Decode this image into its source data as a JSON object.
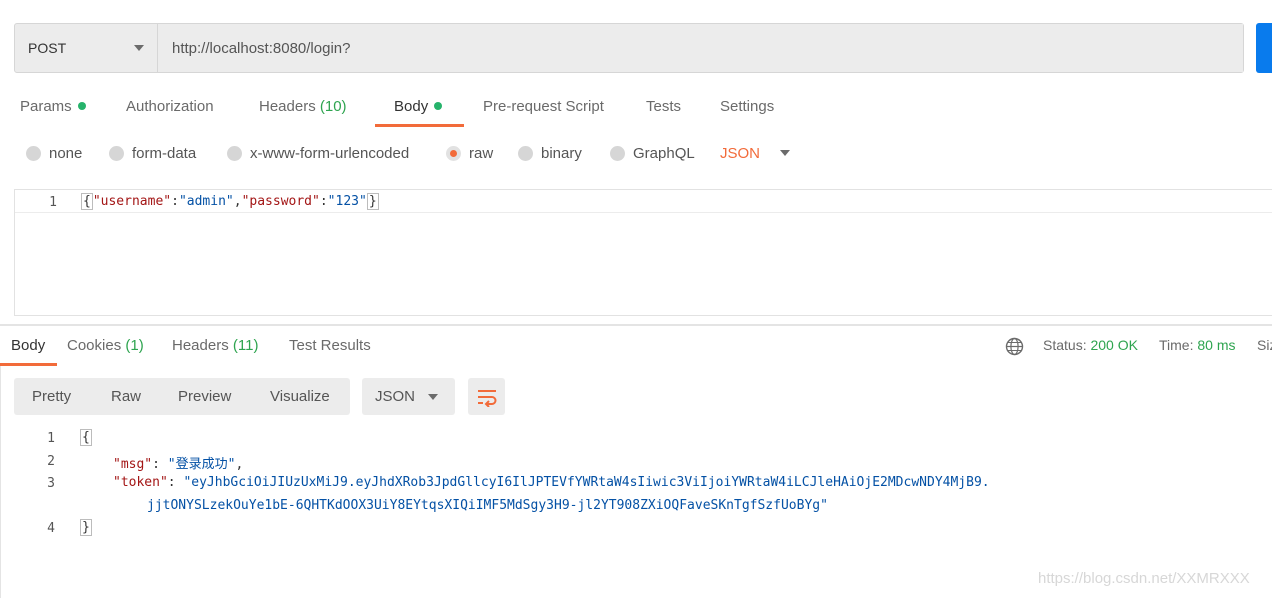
{
  "request": {
    "method": "POST",
    "url": "http://localhost:8080/login?"
  },
  "request_tabs": [
    {
      "label": "Params",
      "dot": true
    },
    {
      "label": "Authorization"
    },
    {
      "label": "Headers",
      "count": "(10)"
    },
    {
      "label": "Body",
      "dot": true,
      "active": true
    },
    {
      "label": "Pre-request Script"
    },
    {
      "label": "Tests"
    },
    {
      "label": "Settings"
    }
  ],
  "body_types": {
    "options": [
      "none",
      "form-data",
      "x-www-form-urlencoded",
      "raw",
      "binary",
      "GraphQL"
    ],
    "selected": "raw",
    "language": "JSON"
  },
  "request_body": {
    "line_numbers": [
      "1"
    ],
    "open": "{",
    "k1": "\"username\"",
    "c1": ":",
    "v1": "\"admin\"",
    "comma": ",",
    "k2": "\"password\"",
    "c2": ":",
    "v2": "\"123\"",
    "close": "}"
  },
  "response_tabs": [
    {
      "label": "Body",
      "active": true
    },
    {
      "label": "Cookies",
      "count": "(1)"
    },
    {
      "label": "Headers",
      "count": "(11)"
    },
    {
      "label": "Test Results"
    }
  ],
  "response_status": {
    "status_label": "Status:",
    "status_value": "200 OK",
    "time_label": "Time:",
    "time_value": "80 ms",
    "size_label": "Siz"
  },
  "response_view": {
    "modes": [
      "Pretty",
      "Raw",
      "Preview",
      "Visualize"
    ],
    "format": "JSON"
  },
  "response_body": {
    "line_numbers": [
      "1",
      "2",
      "3",
      "4"
    ],
    "open": "{",
    "msg_key": "\"msg\"",
    "msg_value": "\"登录成功\"",
    "token_key": "\"token\"",
    "token_line1": "\"eyJhbGciOiJIUzUxMiJ9.eyJhdXRob3JpdGllcyI6IlJPTEVfYWRtaW4sIiwic3ViIjoiYWRtaW4iLCJleHAiOjE2MDcwNDY4MjB9.",
    "token_line2": "jjtONYSLzekOuYe1bE-6QHTKdOOX3UiY8EYtqsXIQiIMF5MdSgy3H9-jl2YT908ZXiOQFaveSKnTgfSzfUoBYg\"",
    "close": "}"
  },
  "watermark": "https://blog.csdn.net/XXMRXXX",
  "colors": {
    "accent": "#f26b3a",
    "send_button": "#097bed",
    "status_ok": "#2ea44f"
  }
}
